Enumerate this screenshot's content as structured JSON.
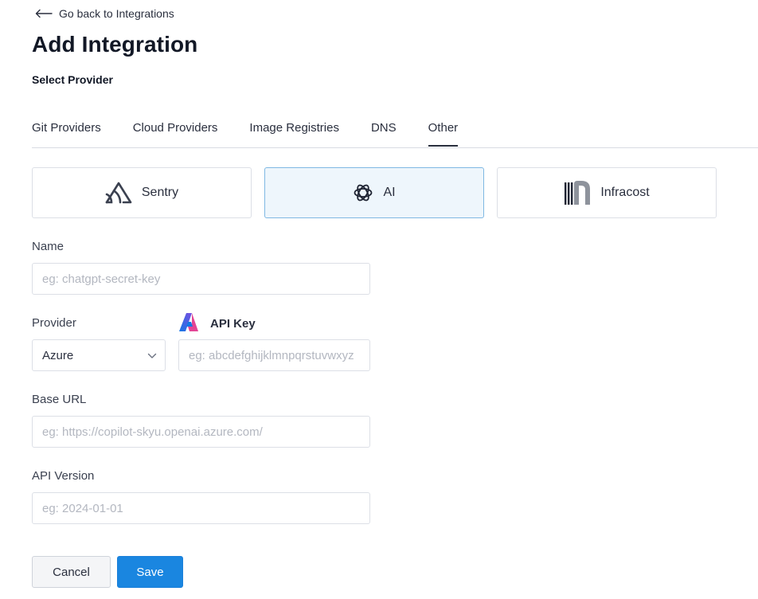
{
  "nav": {
    "back_label": "Go back to Integrations"
  },
  "header": {
    "title": "Add Integration",
    "subtitle": "Select Provider"
  },
  "tabs": [
    {
      "label": "Git Providers",
      "active": false
    },
    {
      "label": "Cloud Providers",
      "active": false
    },
    {
      "label": "Image Registries",
      "active": false
    },
    {
      "label": "DNS",
      "active": false
    },
    {
      "label": "Other",
      "active": true
    }
  ],
  "providers": [
    {
      "label": "Sentry",
      "icon": "sentry-icon",
      "selected": false
    },
    {
      "label": "AI",
      "icon": "openai-icon",
      "selected": true
    },
    {
      "label": "Infracost",
      "icon": "infracost-icon",
      "selected": false
    }
  ],
  "form": {
    "name": {
      "label": "Name",
      "placeholder": "eg: chatgpt-secret-key",
      "value": ""
    },
    "provider": {
      "label": "Provider",
      "value": "Azure",
      "icon": "azure-icon"
    },
    "api_key": {
      "label": "API Key",
      "placeholder": "eg: abcdefghijklmnpqrstuvwxyz",
      "value": ""
    },
    "base_url": {
      "label": "Base URL",
      "placeholder": "eg: https://copilot-skyu.openai.azure.com/",
      "value": ""
    },
    "api_version": {
      "label": "API Version",
      "placeholder": "eg: 2024-01-01",
      "value": ""
    }
  },
  "actions": {
    "cancel_label": "Cancel",
    "save_label": "Save"
  },
  "colors": {
    "accent": "#1a86e0",
    "selected_card_bg": "#eef6fc",
    "border": "#dcdfe6"
  }
}
